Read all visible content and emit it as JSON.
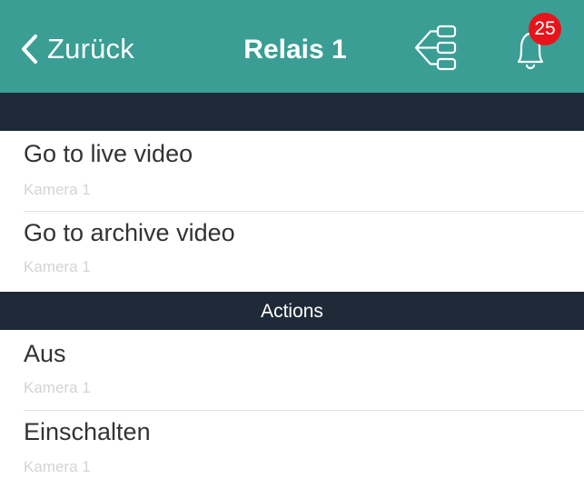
{
  "navbar": {
    "back_label": "Zurück",
    "title": "Relais 1",
    "notification_count": "25",
    "icons": {
      "back": "chevron-left-icon",
      "tree": "tree-structure-icon",
      "bell": "bell-icon"
    },
    "colors": {
      "background": "#3a9e95",
      "badge": "#e8141b"
    }
  },
  "sections": [
    {
      "header": "",
      "items": [
        {
          "title": "Go to live video",
          "subtitle": "Kamera 1"
        },
        {
          "title": "Go to archive video",
          "subtitle": "Kamera 1"
        }
      ]
    },
    {
      "header": "Actions",
      "items": [
        {
          "title": "Aus",
          "subtitle": "Kamera 1"
        },
        {
          "title": "Einschalten",
          "subtitle": "Kamera 1"
        }
      ]
    }
  ],
  "colors": {
    "section_header": "#1f2a38",
    "subtitle": "#d4d4d4"
  }
}
